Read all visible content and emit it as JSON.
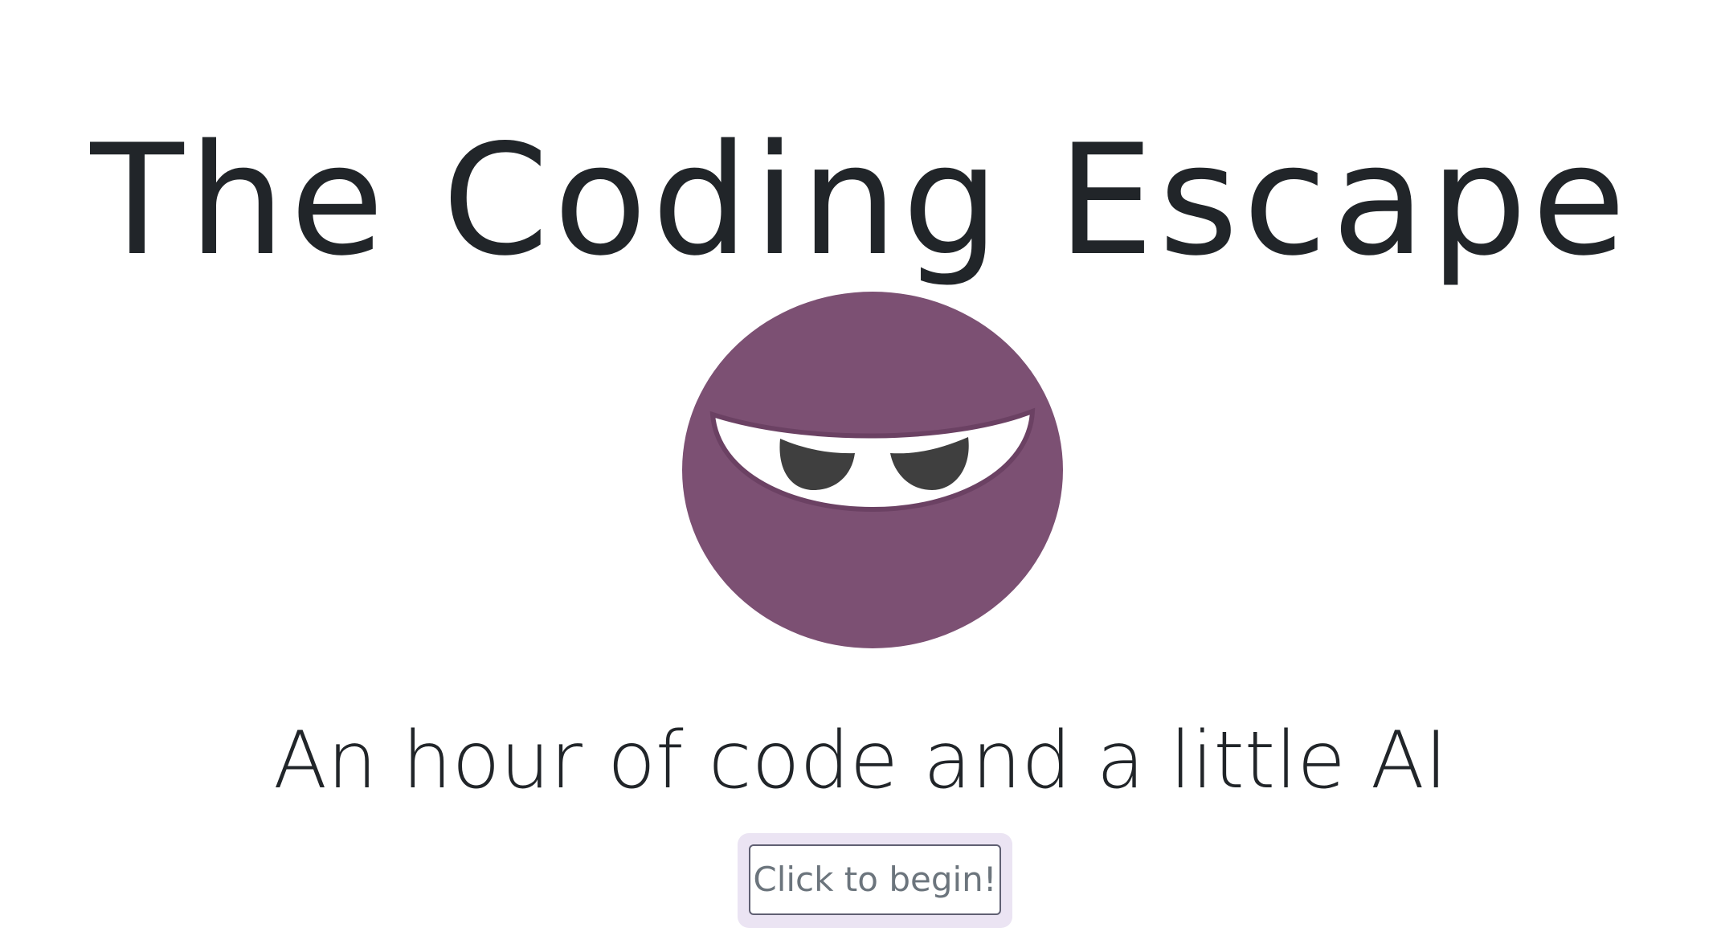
{
  "header": {
    "title": "The Coding Escape"
  },
  "logo": {
    "icon": "ninja-mascot-icon",
    "colors": {
      "head": "#7c5073",
      "head_outline": "#6b4163",
      "eye_band": "#ffffff",
      "pupil": "#3f3f3f"
    }
  },
  "main": {
    "subtitle": "An hour of code and a little AI",
    "start_button_label": "Click to begin!"
  },
  "theme": {
    "text": "#212529",
    "button_text": "#6c757d",
    "button_focus_ring": "#ebe4f3"
  }
}
